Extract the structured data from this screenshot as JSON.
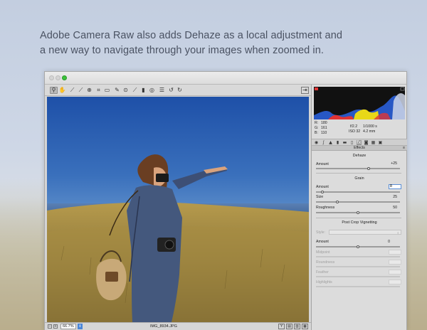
{
  "headline": {
    "line1": "Adobe Camera Raw also adds Dehaze as a local adjustment and",
    "line2": "a new way to navigate through your images when zoomed in."
  },
  "window": {
    "traffic_lights": [
      "#d9d9d9",
      "#d9d9d9",
      "#3cc23c"
    ],
    "toolbar_icons": [
      "zoom-icon",
      "hand-icon",
      "white-balance-icon",
      "color-sampler-icon",
      "target-adjust-icon",
      "crop-icon",
      "straighten-icon",
      "spot-removal-icon",
      "red-eye-icon",
      "adjustment-brush-icon",
      "graduated-filter-icon",
      "radial-filter-icon",
      "preferences-icon",
      "rotate-ccw-icon",
      "rotate-cw-icon"
    ]
  },
  "status": {
    "zoom": "66.7%",
    "filename": "IMG_8934.JPG"
  },
  "info": {
    "r_label": "R:",
    "r_value": "180",
    "g_label": "G:",
    "g_value": "161",
    "b_label": "B:",
    "b_value": "110",
    "aperture": "f/2.2",
    "shutter": "1/1000 s",
    "iso": "ISO 32",
    "focal": "4.2 mm"
  },
  "panel": {
    "section_title": "Effects",
    "dehaze": {
      "title": "Dehaze",
      "amount_label": "Amount",
      "amount_value": "+25",
      "amount_level": 0.625
    },
    "grain": {
      "title": "Grain",
      "amount_label": "Amount",
      "amount_value": "8",
      "amount_level": 0.08,
      "size_label": "Size",
      "size_value": "25",
      "size_level": 0.25,
      "roughness_label": "Roughness",
      "roughness_value": "50",
      "roughness_level": 0.5
    },
    "vignette": {
      "title": "Post Crop Vignetting",
      "style_label": "Style:",
      "amount_label": "Amount",
      "amount_value": "0",
      "amount_level": 0.5,
      "midpoint_label": "Midpoint",
      "roundness_label": "Roundness",
      "feather_label": "Feather",
      "highlights_label": "Highlights"
    }
  },
  "colors": {
    "accent": "#3cc23c",
    "histogram_blue": "#2a5fd9",
    "histogram_yellow": "#e8d818",
    "histogram_red": "#e03434"
  }
}
